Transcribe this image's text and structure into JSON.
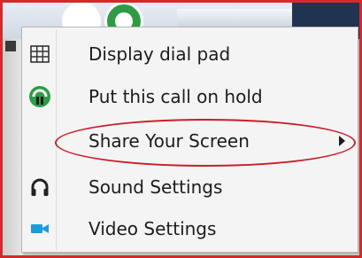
{
  "menu": {
    "items": [
      {
        "label": "Display dial pad",
        "icon": "dialpad-icon"
      },
      {
        "label": "Put this call on hold",
        "icon": "call-hold-icon"
      },
      {
        "label": "Share Your Screen",
        "icon": "",
        "has_submenu": true,
        "highlighted": true
      },
      {
        "label": "Sound Settings",
        "icon": "headset-icon"
      },
      {
        "label": "Video Settings",
        "icon": "video-camera-icon"
      }
    ]
  },
  "colors": {
    "highlight_ring": "#c91f2a",
    "frame": "#d42a2a",
    "hold_icon": "#2e9b46",
    "video_icon": "#1e9bd7"
  }
}
